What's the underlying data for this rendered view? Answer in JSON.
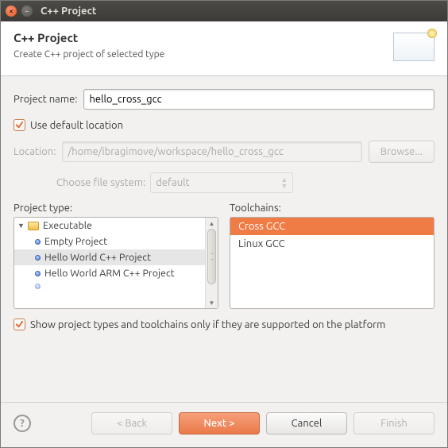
{
  "window_title": "C++ Project",
  "header": {
    "title": "C++ Project",
    "subtitle": "Create C++ project of selected type"
  },
  "project_name_label": "Project name:",
  "project_name_value": "hello_cross_gcc",
  "use_default_location_label": "Use default location",
  "location_label": "Location:",
  "location_value": "/home/ibragimove/workspace/hello_cross_gcc",
  "browse_label": "Browse...",
  "filesystem_label": "Choose file system:",
  "filesystem_value": "default",
  "project_type_label": "Project type:",
  "toolchains_label": "Toolchains:",
  "project_types": {
    "root": "Executable",
    "items": [
      "Empty Project",
      "Hello World C++ Project",
      "Hello World ARM C++ Project"
    ]
  },
  "toolchains": [
    "Cross GCC",
    "Linux GCC"
  ],
  "show_supported_label": "Show project types and toolchains only if they are supported on the platform",
  "buttons": {
    "back": "< Back",
    "next": "Next >",
    "cancel": "Cancel",
    "finish": "Finish"
  }
}
